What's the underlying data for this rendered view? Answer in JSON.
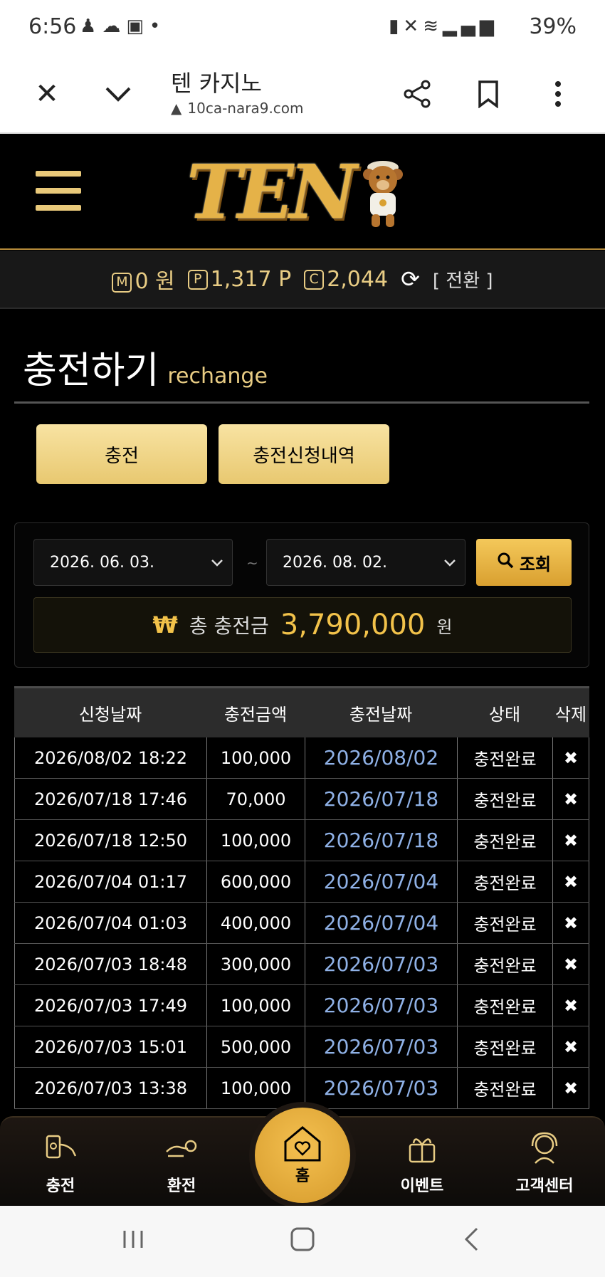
{
  "status_bar": {
    "time": "6:56",
    "left_icons": [
      "person-icon",
      "cloud-icon",
      "image-icon",
      "dot-icon"
    ],
    "right_icons": [
      "battery-saver-icon",
      "mute-icon",
      "wifi-icon",
      "volte-icon",
      "signal-icon"
    ],
    "battery": "39%"
  },
  "browser": {
    "page_title": "텐 카지노",
    "url": "10ca-nara9.com"
  },
  "balance": {
    "money_badge": "M",
    "money": "0 원",
    "point_badge": "P",
    "points": "1,317 P",
    "coin_badge": "C",
    "coins": "2,044",
    "switch_label": "[ 전환 ]"
  },
  "page": {
    "title": "충전하기",
    "subtitle": "rechange"
  },
  "tabs": {
    "charge": "충전",
    "history": "충전신청내역"
  },
  "filter": {
    "start_date": "2026. 06. 03.",
    "separator": "~",
    "end_date": "2026. 08. 02.",
    "search_label": "조회",
    "total_symbol": "₩",
    "total_label": "총 충전금",
    "total_value": "3,790,000",
    "total_unit": "원"
  },
  "table": {
    "headers": [
      "신청날짜",
      "충전금액",
      "충전날짜",
      "상태",
      "삭제"
    ],
    "rows": [
      {
        "requested": "2026/08/02 18:22",
        "amount": "100,000",
        "charged": "2026/08/02",
        "status": "충전완료",
        "delete": "✖"
      },
      {
        "requested": "2026/07/18 17:46",
        "amount": "70,000",
        "charged": "2026/07/18",
        "status": "충전완료",
        "delete": "✖"
      },
      {
        "requested": "2026/07/18 12:50",
        "amount": "100,000",
        "charged": "2026/07/18",
        "status": "충전완료",
        "delete": "✖"
      },
      {
        "requested": "2026/07/04 01:17",
        "amount": "600,000",
        "charged": "2026/07/04",
        "status": "충전완료",
        "delete": "✖"
      },
      {
        "requested": "2026/07/04 01:03",
        "amount": "400,000",
        "charged": "2026/07/04",
        "status": "충전완료",
        "delete": "✖"
      },
      {
        "requested": "2026/07/03 18:48",
        "amount": "300,000",
        "charged": "2026/07/03",
        "status": "충전완료",
        "delete": "✖"
      },
      {
        "requested": "2026/07/03 17:49",
        "amount": "100,000",
        "charged": "2026/07/03",
        "status": "충전완료",
        "delete": "✖"
      },
      {
        "requested": "2026/07/03 15:01",
        "amount": "500,000",
        "charged": "2026/07/03",
        "status": "충전완료",
        "delete": "✖"
      },
      {
        "requested": "2026/07/03 13:38",
        "amount": "100,000",
        "charged": "2026/07/03",
        "status": "충전완료",
        "delete": "✖"
      }
    ]
  },
  "bottom_nav": {
    "charge": "충전",
    "exchange": "환전",
    "home": "홈",
    "event": "이벤트",
    "support": "고객센터"
  },
  "colors": {
    "gold": "#e8cc84",
    "button_gold": "#f2c24a",
    "link_blue": "#8fb1e6",
    "background": "#000000"
  }
}
